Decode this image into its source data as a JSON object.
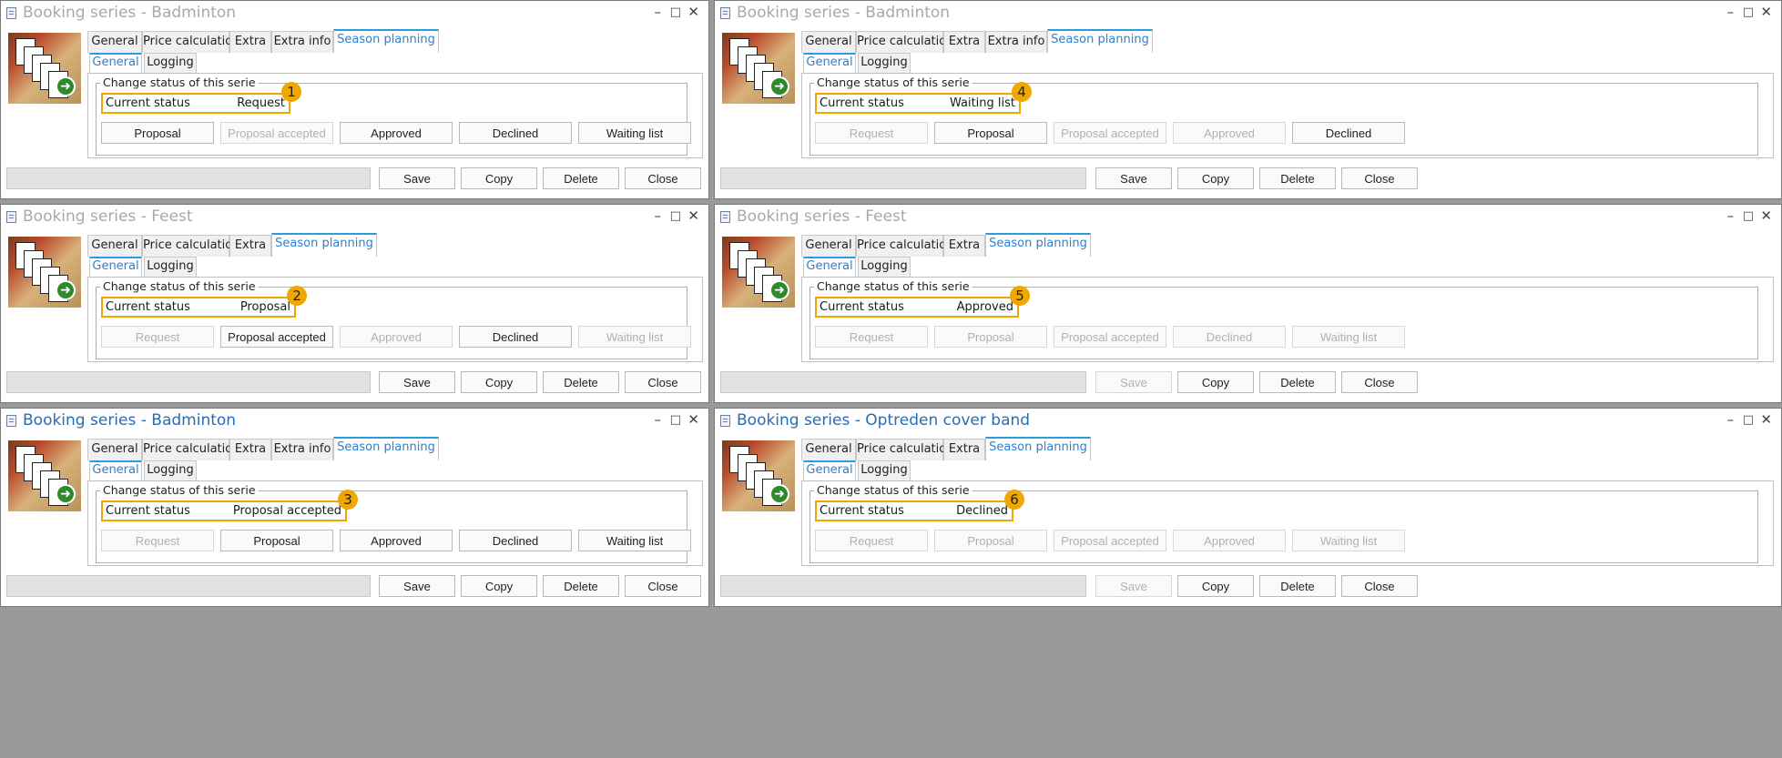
{
  "colors": {
    "highlight": "#f0a800",
    "active_title": "#2b6cb0",
    "inactive_title": "#a8a8a8",
    "tab_accent": "#2b9be0"
  },
  "window_controls": {
    "minimize": "–",
    "maximize": "□",
    "close": "✕"
  },
  "windows": [
    {
      "title": "Booking series - Badminton",
      "tabs": [
        "General",
        "Price calculation",
        "Extra",
        "Extra info",
        "Season planning"
      ],
      "subtabs": [
        "General",
        "Logging"
      ],
      "group_label": "Change status of this serie",
      "status_label": "Current status",
      "status_value": "Request",
      "badge": "1",
      "buttons": [
        "Proposal",
        "Proposal accepted",
        "Approved",
        "Declined",
        "Waiting list"
      ],
      "buttons_disabled": [
        false,
        true,
        false,
        false,
        false
      ],
      "footer": [
        "Save",
        "Copy",
        "Delete",
        "Close"
      ],
      "footer_disabled": [
        false,
        false,
        false,
        false
      ]
    },
    {
      "title": "Booking series - Badminton",
      "tabs": [
        "General",
        "Price calculation",
        "Extra",
        "Extra info",
        "Season planning"
      ],
      "subtabs": [
        "General",
        "Logging"
      ],
      "group_label": "Change status of this serie",
      "status_label": "Current status",
      "status_value": "Waiting list",
      "badge": "4",
      "buttons": [
        "Request",
        "Proposal",
        "Proposal accepted",
        "Approved",
        "Declined"
      ],
      "buttons_disabled": [
        true,
        false,
        true,
        true,
        false
      ],
      "footer": [
        "Save",
        "Copy",
        "Delete",
        "Close"
      ],
      "footer_disabled": [
        false,
        false,
        false,
        false
      ]
    },
    {
      "title": "Booking series - Feest",
      "tabs": [
        "General",
        "Price calculation",
        "Extra",
        "Season planning"
      ],
      "subtabs": [
        "General",
        "Logging"
      ],
      "group_label": "Change status of this serie",
      "status_label": "Current status",
      "status_value": "Proposal",
      "badge": "2",
      "buttons": [
        "Request",
        "Proposal accepted",
        "Approved",
        "Declined",
        "Waiting list"
      ],
      "buttons_disabled": [
        true,
        false,
        true,
        false,
        true
      ],
      "footer": [
        "Save",
        "Copy",
        "Delete",
        "Close"
      ],
      "footer_disabled": [
        false,
        false,
        false,
        false
      ]
    },
    {
      "title": "Booking series - Feest",
      "tabs": [
        "General",
        "Price calculation",
        "Extra",
        "Season planning"
      ],
      "subtabs": [
        "General",
        "Logging"
      ],
      "group_label": "Change status of this serie",
      "status_label": "Current status",
      "status_value": "Approved",
      "badge": "5",
      "buttons": [
        "Request",
        "Proposal",
        "Proposal accepted",
        "Declined",
        "Waiting list"
      ],
      "buttons_disabled": [
        true,
        true,
        true,
        true,
        true
      ],
      "footer": [
        "Save",
        "Copy",
        "Delete",
        "Close"
      ],
      "footer_disabled": [
        true,
        false,
        false,
        false
      ]
    },
    {
      "title": "Booking series - Badminton",
      "tabs": [
        "General",
        "Price calculation",
        "Extra",
        "Extra info",
        "Season planning"
      ],
      "subtabs": [
        "General",
        "Logging"
      ],
      "group_label": "Change status of this serie",
      "status_label": "Current status",
      "status_value": "Proposal accepted",
      "badge": "3",
      "buttons": [
        "Request",
        "Proposal",
        "Approved",
        "Declined",
        "Waiting list"
      ],
      "buttons_disabled": [
        true,
        false,
        false,
        false,
        false
      ],
      "footer": [
        "Save",
        "Copy",
        "Delete",
        "Close"
      ],
      "footer_disabled": [
        false,
        false,
        false,
        false
      ]
    },
    {
      "title": "Booking series - Optreden cover band",
      "tabs": [
        "General",
        "Price calculation",
        "Extra",
        "Season planning"
      ],
      "subtabs": [
        "General",
        "Logging"
      ],
      "group_label": "Change status of this serie",
      "status_label": "Current status",
      "status_value": "Declined",
      "badge": "6",
      "buttons": [
        "Request",
        "Proposal",
        "Proposal accepted",
        "Approved",
        "Waiting list"
      ],
      "buttons_disabled": [
        true,
        true,
        true,
        true,
        true
      ],
      "footer": [
        "Save",
        "Copy",
        "Delete",
        "Close"
      ],
      "footer_disabled": [
        true,
        false,
        false,
        false
      ]
    }
  ]
}
